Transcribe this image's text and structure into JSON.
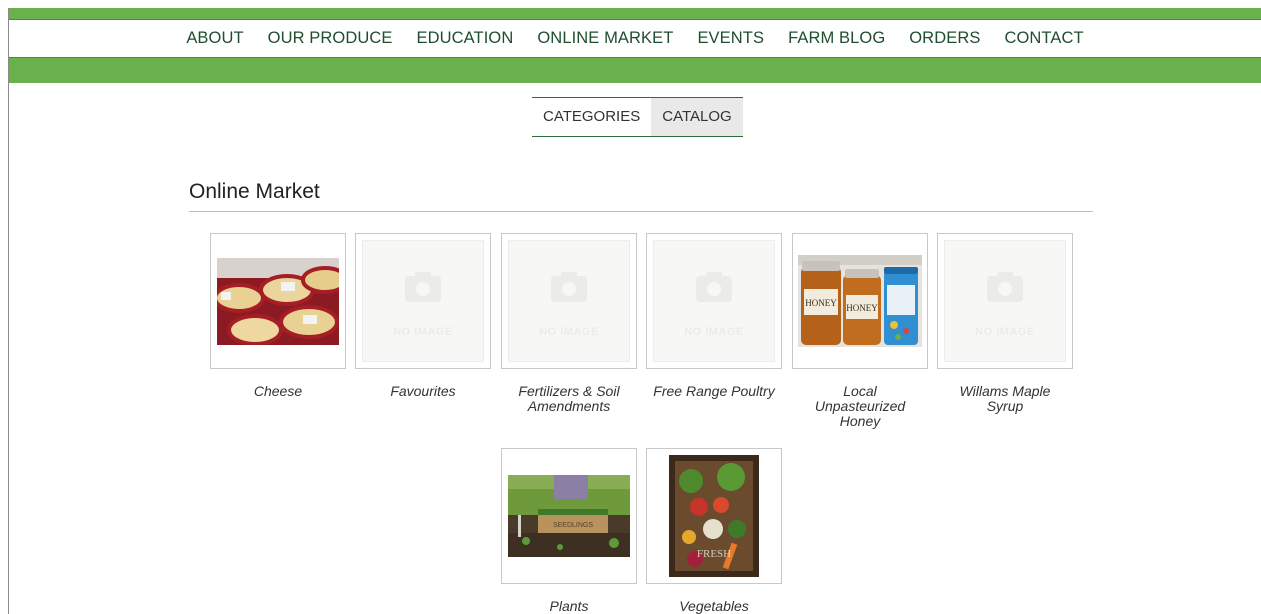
{
  "nav": {
    "items": [
      "ABOUT",
      "OUR PRODUCE",
      "EDUCATION",
      "ONLINE MARKET",
      "EVENTS",
      "FARM BLOG",
      "ORDERS",
      "CONTACT"
    ]
  },
  "tabs": {
    "categories": "CATEGORIES",
    "catalog": "CATALOG",
    "active": "catalog"
  },
  "market": {
    "title": "Online Market",
    "no_image_text": "NO IMAGE",
    "categories": [
      {
        "label": "Cheese",
        "image": "cheese-photo"
      },
      {
        "label": "Favourites",
        "image": "no-image"
      },
      {
        "label": "Fertilizers & Soil Amendments",
        "image": "no-image"
      },
      {
        "label": "Free Range Poultry",
        "image": "no-image"
      },
      {
        "label": "Local Unpasteurized Honey",
        "image": "honey-photo"
      },
      {
        "label": "Willams Maple Syrup",
        "image": "no-image"
      },
      {
        "label": "Plants",
        "image": "plants-photo"
      },
      {
        "label": "Vegetables",
        "image": "vegetables-photo"
      }
    ]
  },
  "colors": {
    "nav_bar": "#6ab04c",
    "nav_text": "#1f4d2e",
    "tab_active_bg": "#e9e9e9"
  }
}
